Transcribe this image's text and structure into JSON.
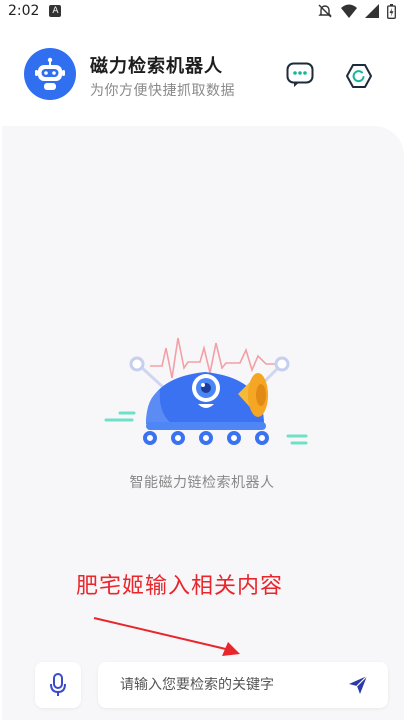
{
  "status_bar": {
    "time": "2:02",
    "notif_label": "A"
  },
  "header": {
    "title": "磁力检索机器人",
    "subtitle": "为你方便快捷抓取数据"
  },
  "hero": {
    "caption": "智能磁力链检索机器人"
  },
  "annotation": {
    "text": "肥宅姬输入相关内容"
  },
  "search": {
    "placeholder": "请输入您要检索的关键字",
    "value": ""
  },
  "colors": {
    "brand_blue": "#2f6ff0",
    "accent_teal": "#18b59a",
    "annotation_red": "#e8262b",
    "panel_bg": "#f7f7f9"
  },
  "icons": {
    "avatar": "robot-icon",
    "chat": "chat-bubble-icon",
    "settings": "hexagon-icon",
    "mic": "microphone-icon",
    "send": "send-icon"
  }
}
